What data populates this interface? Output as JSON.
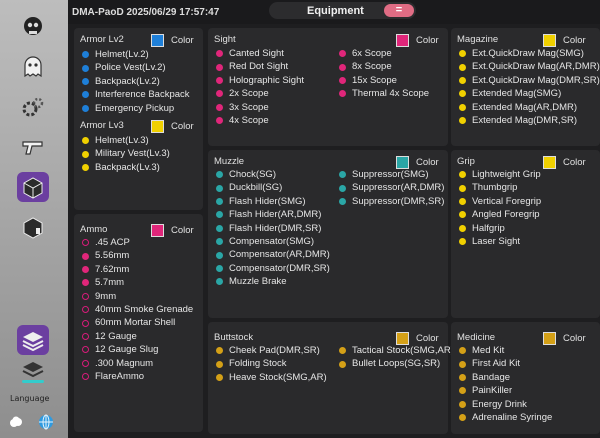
{
  "app_title": "DMA-PaoD 2025/06/29 17:57:47",
  "tab": {
    "label": "Equipment",
    "minus": "="
  },
  "color_label": "Color",
  "sidebar": {
    "language_label": "Language"
  },
  "colors": {
    "blue": "#1e7fd8",
    "yellow": "#f0d000",
    "pink": "#e0267a",
    "teal": "#2aa6a6",
    "gold": "#d4a017",
    "purple": "#6b3fa0"
  },
  "panels": {
    "armor_lv2": {
      "title": "Armor Lv2",
      "items": [
        "Helmet(Lv.2)",
        "Police Vest(Lv.2)",
        "Backpack(Lv.2)",
        "Interference Backpack",
        "Emergency Pickup"
      ]
    },
    "armor_lv3": {
      "title": "Armor Lv3",
      "items": [
        "Helmet(Lv.3)",
        "Military Vest(Lv.3)",
        "Backpack(Lv.3)"
      ]
    },
    "ammo": {
      "title": "Ammo",
      "items": [
        ".45 ACP",
        "5.56mm",
        "7.62mm",
        "5.7mm",
        "9mm",
        "40mm Smoke Grenade",
        "60mm Mortar Shell",
        "12 Gauge",
        "12 Gauge Slug",
        ".300 Magnum",
        "FlareAmmo"
      ],
      "filled": [
        false,
        true,
        true,
        true,
        false,
        false,
        false,
        false,
        false,
        false,
        false
      ]
    },
    "sight": {
      "title": "Sight",
      "col1": [
        "Canted Sight",
        "Red Dot Sight",
        "Holographic Sight",
        "2x Scope",
        "3x Scope",
        "4x Scope"
      ],
      "col2": [
        "6x Scope",
        "8x Scope",
        "15x Scope",
        "Thermal 4x Scope"
      ]
    },
    "magazine": {
      "title": "Magazine",
      "items": [
        "Ext.QuickDraw Mag(SMG)",
        "Ext.QuickDraw Mag(AR,DMR)",
        "Ext.QuickDraw Mag(DMR,SR)",
        "Extended Mag(SMG)",
        "Extended Mag(AR,DMR)",
        "Extended Mag(DMR,SR)"
      ]
    },
    "muzzle": {
      "title": "Muzzle",
      "col1": [
        "Chock(SG)",
        "Duckbill(SG)",
        "Flash Hider(SMG)",
        "Flash Hider(AR,DMR)",
        "Flash Hider(DMR,SR)",
        "Compensator(SMG)",
        "Compensator(AR,DMR)",
        "Compensator(DMR,SR)",
        "Muzzle Brake"
      ],
      "col2": [
        "Suppressor(SMG)",
        "Suppressor(AR,DMR)",
        "Suppressor(DMR,SR)"
      ]
    },
    "grip": {
      "title": "Grip",
      "items": [
        "Lightweight Grip",
        "Thumbgrip",
        "Vertical Foregrip",
        "Angled Foregrip",
        "Halfgrip",
        "Laser Sight"
      ]
    },
    "buttstock": {
      "title": "Buttstock",
      "col1": [
        "Cheek Pad(DMR,SR)",
        "Folding Stock",
        "Heave Stock(SMG,AR)"
      ],
      "col2": [
        "Tactical Stock(SMG,AR)",
        "Bullet Loops(SG,SR)"
      ]
    },
    "medicine": {
      "title": "Medicine",
      "items": [
        "Med Kit",
        "First Aid Kit",
        "Bandage",
        "PainKiller",
        "Energy Drink",
        "Adrenaline Syringe"
      ]
    }
  }
}
